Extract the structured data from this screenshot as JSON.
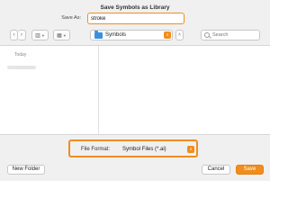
{
  "window": {
    "title": "Save Symbols as Library"
  },
  "save_as": {
    "label": "Save As:",
    "value": "stroke"
  },
  "toolbar": {
    "back_icon": "chevron-left-icon",
    "forward_icon": "chevron-right-icon",
    "view_list_icon": "column-view-icon",
    "view_grid_icon": "grid-view-icon",
    "location": {
      "label": "Symbols",
      "icon": "folder-icon"
    },
    "search": {
      "placeholder": "Search"
    }
  },
  "browser": {
    "group_header": "Today"
  },
  "format": {
    "label": "File Format:",
    "value": "Symbol Files (*.ai)"
  },
  "buttons": {
    "new_folder": "New Folder",
    "cancel": "Cancel",
    "save": "Save"
  },
  "colors": {
    "accent": "#f28c1c",
    "folder": "#3b8fe0"
  }
}
